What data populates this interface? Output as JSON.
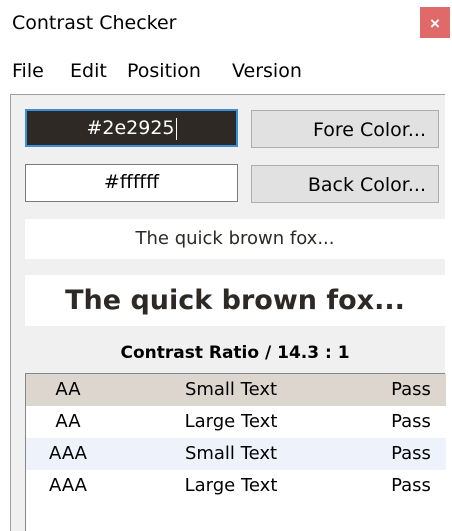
{
  "window": {
    "title": "Contrast Checker",
    "close_glyph": "×"
  },
  "menu": [
    "File",
    "Edit",
    "Position",
    "Version"
  ],
  "fore": {
    "value": "#2e2925",
    "button_label": "Fore Color..."
  },
  "back": {
    "value": "#ffffff",
    "button_label": "Back Color..."
  },
  "sample": {
    "small_text": "The quick brown fox...",
    "large_text": "The quick brown fox..."
  },
  "ratio_text": "Contrast Ratio / 14.3 : 1",
  "results": [
    {
      "level": "AA",
      "type": "Small Text",
      "result": "Pass",
      "bg": "#dcd6cf"
    },
    {
      "level": "AA",
      "type": "Large Text",
      "result": "Pass",
      "bg": "#ffffff"
    },
    {
      "level": "AAA",
      "type": "Small Text",
      "result": "Pass",
      "bg": "#eef3fb"
    },
    {
      "level": "AAA",
      "type": "Large Text",
      "result": "Pass",
      "bg": "#ffffff"
    }
  ],
  "colors": {
    "fore": "#2e2925",
    "back": "#ffffff",
    "close_bg": "#e06a6a",
    "focus_border": "#3c8ed8"
  }
}
